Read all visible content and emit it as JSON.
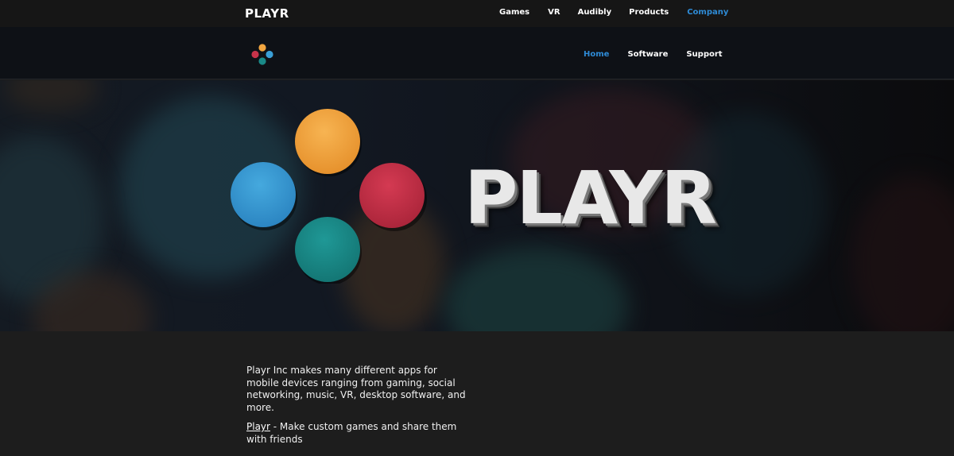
{
  "brand": "PLAYR",
  "top_nav": [
    {
      "label": "Games",
      "active": false
    },
    {
      "label": "VR",
      "active": false
    },
    {
      "label": "Audibly",
      "active": false
    },
    {
      "label": "Products",
      "active": false
    },
    {
      "label": "Company",
      "active": true
    }
  ],
  "sub_nav": [
    {
      "label": "Home",
      "active": true
    },
    {
      "label": "Software",
      "active": false
    },
    {
      "label": "Support",
      "active": false
    }
  ],
  "hero": {
    "wordmark": "PLAYR"
  },
  "content": {
    "intro": "Playr Inc makes many different apps for mobile devices ranging from gaming, social networking, music, VR, desktop software, and more.",
    "items": [
      {
        "link": "Playr",
        "text": " - Make custom games and share them with friends"
      }
    ]
  },
  "colors": {
    "accent": "#2e8bd6",
    "dot_orange": "#f2a640",
    "dot_blue": "#3a9fd6",
    "dot_red": "#c8334a",
    "dot_teal": "#1a8a88"
  },
  "icons": {
    "logo": "four-dot-controller-logo"
  }
}
